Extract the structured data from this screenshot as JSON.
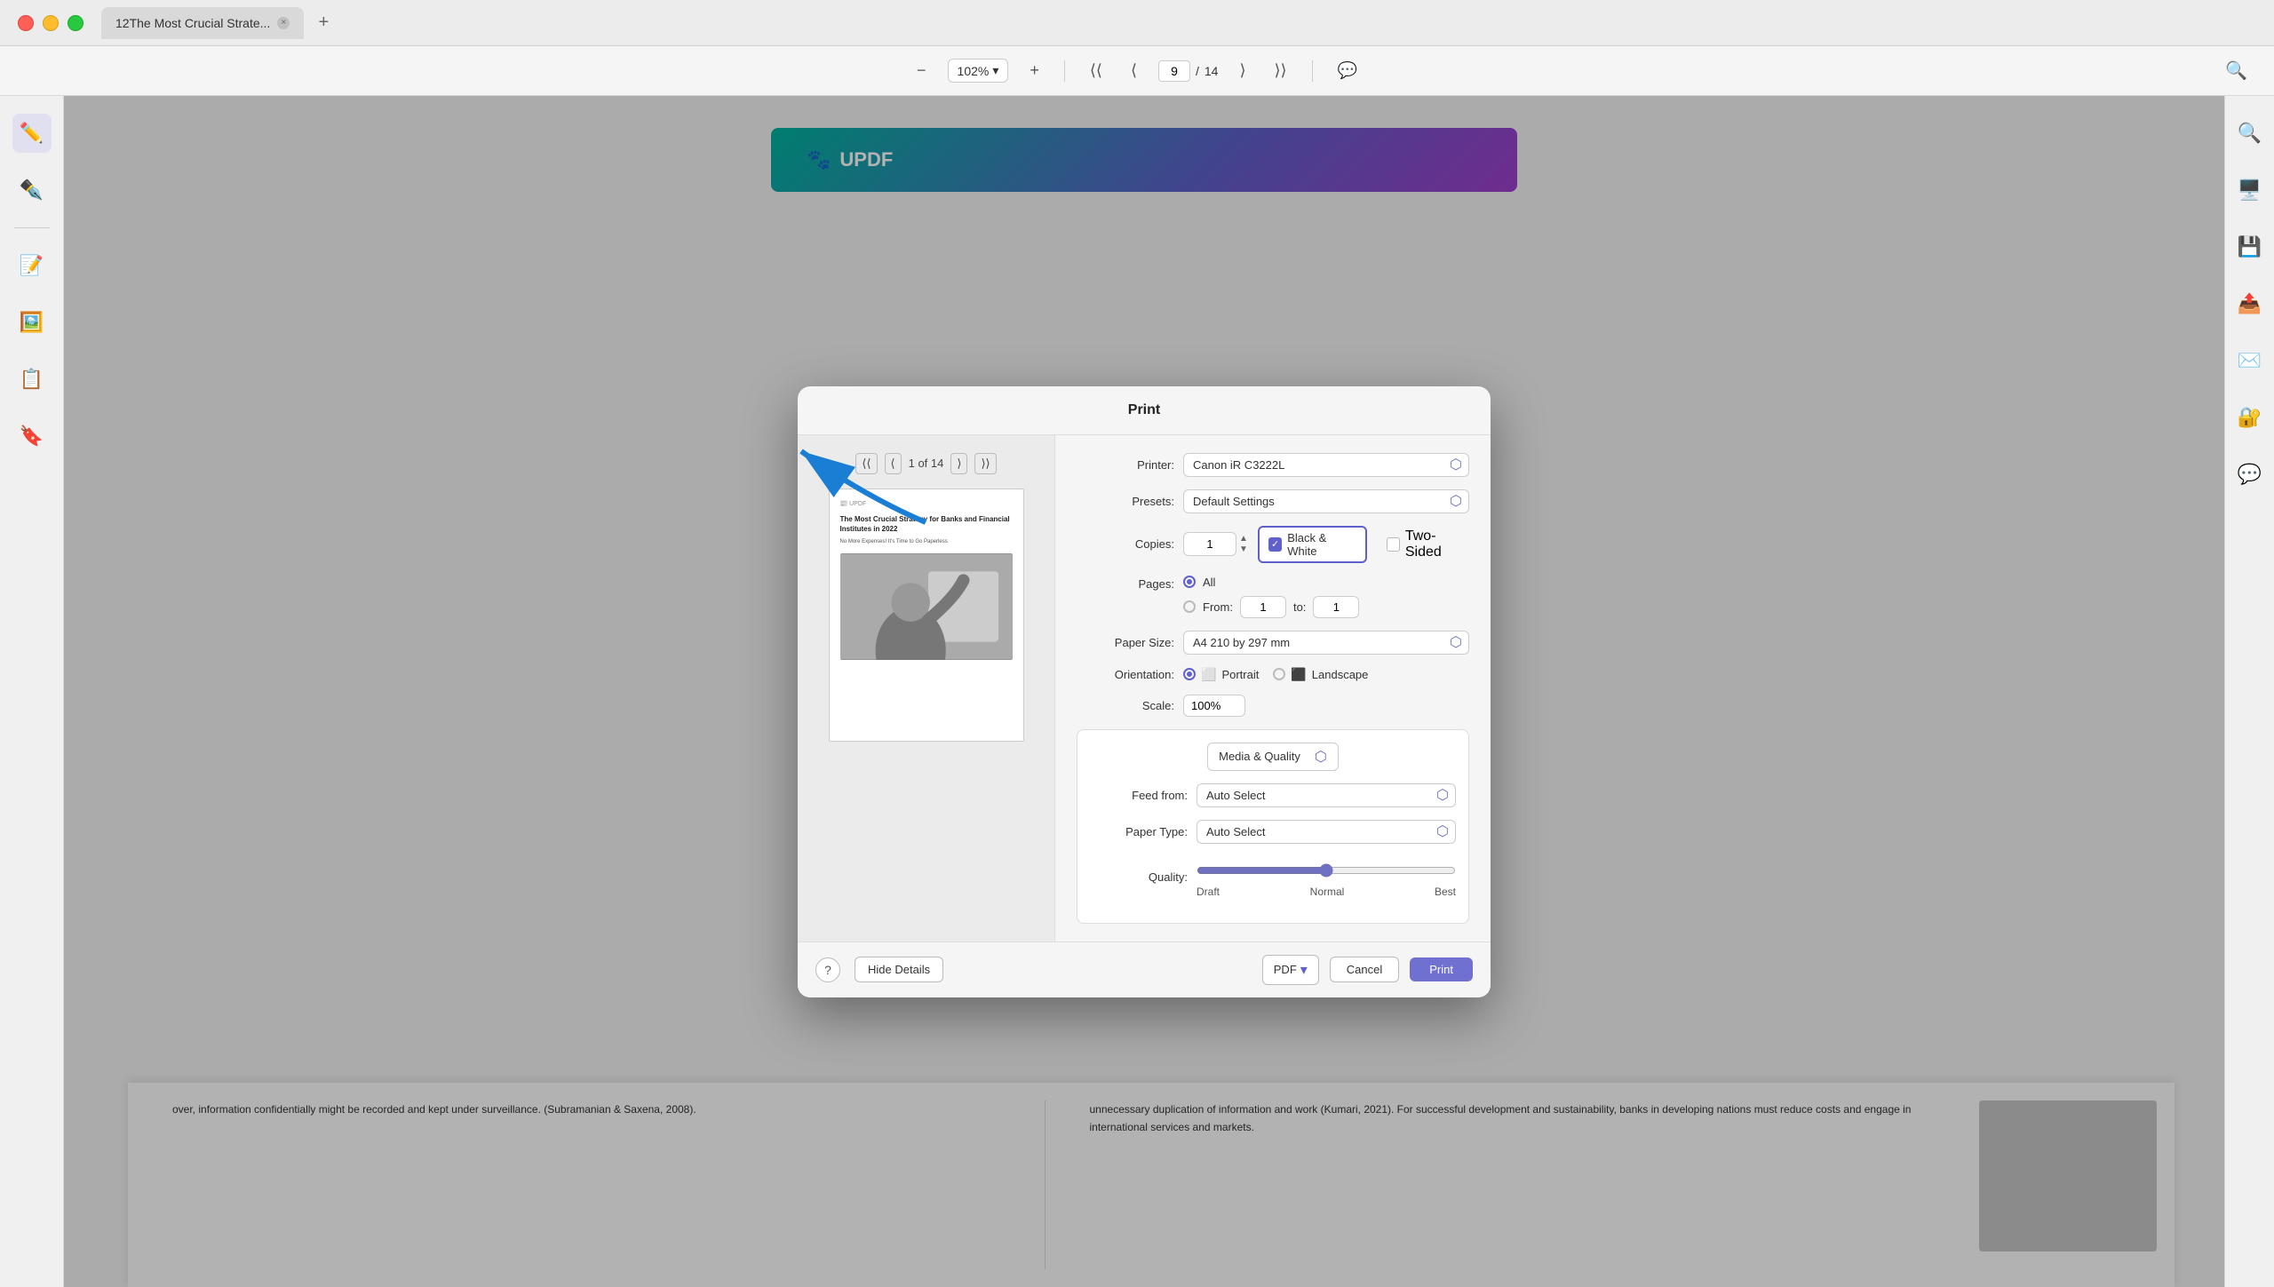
{
  "window": {
    "title": "12The Most Crucial Strate..."
  },
  "toolbar": {
    "zoom_value": "102%",
    "page_current": "9",
    "page_total": "14",
    "zoom_in_label": "+",
    "zoom_out_label": "−"
  },
  "updf": {
    "logo_text": "UPDF",
    "logo_icon": "🐾"
  },
  "print_dialog": {
    "title": "Print",
    "printer_label": "Printer:",
    "printer_value": "Canon iR C3222L",
    "presets_label": "Presets:",
    "presets_value": "Default Settings",
    "copies_label": "Copies:",
    "copies_value": "1",
    "bw_label": "Black & White",
    "two_sided_label": "Two-Sided",
    "pages_label": "Pages:",
    "pages_all": "All",
    "pages_from": "From:",
    "pages_from_value": "1",
    "pages_to": "to:",
    "pages_to_value": "1",
    "paper_size_label": "Paper Size:",
    "paper_size_value": "A4  210 by 297 mm",
    "orientation_label": "Orientation:",
    "portrait_label": "Portrait",
    "landscape_label": "Landscape",
    "scale_label": "Scale:",
    "scale_value": "100%",
    "media_quality_label": "Media & Quality",
    "feed_from_label": "Feed from:",
    "feed_from_value": "Auto Select",
    "paper_type_label": "Paper Type:",
    "paper_type_value": "Auto Select",
    "quality_label": "Quality:",
    "quality_draft": "Draft",
    "quality_normal": "Normal",
    "quality_best": "Best",
    "preview_page": "1 of 14",
    "doc_title": "The Most Crucial Strategy for Banks and Financial Institutes in 2022",
    "doc_subtitle": "No More Expenses! It's Time to Go Paperless"
  },
  "footer": {
    "help_label": "?",
    "hide_details_label": "Hide Details",
    "pdf_label": "PDF",
    "cancel_label": "Cancel",
    "print_label": "Print"
  },
  "sidebar": {
    "icons": [
      "✏️",
      "✒️",
      "📝",
      "🖼️",
      "📋",
      "🔖"
    ]
  },
  "right_sidebar": {
    "icons": [
      "🔍",
      "🖥️",
      "💾",
      "📤",
      "✉️",
      "🔐",
      "💬"
    ]
  },
  "doc_content": {
    "col1_text": "over, information confidentially might be recorded and kept under surveillance. (Subramanian & Saxena, 2008).",
    "col2_text": "unnecessary duplication of information and work (Kumari, 2021). For successful development and sustainability, banks in developing nations must reduce costs and engage in international services and markets."
  }
}
